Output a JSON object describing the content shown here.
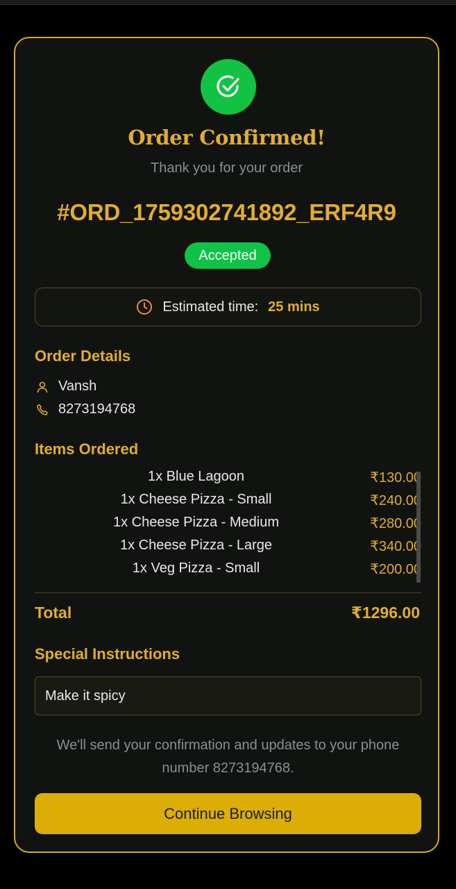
{
  "header": {
    "title": "Order Confirmed!",
    "subtitle": "Thank you for your order"
  },
  "order": {
    "id": "#ORD_1759302741892_ERF4R9",
    "status": "Accepted",
    "eta_label": "Estimated time:",
    "eta_value": "25 mins"
  },
  "details": {
    "section_title": "Order Details",
    "customer_name": "Vansh",
    "phone": "8273194768"
  },
  "items_section": {
    "section_title": "Items Ordered",
    "items": [
      {
        "name": "1x Blue Lagoon",
        "price": "₹130.00"
      },
      {
        "name": "1x Cheese Pizza - Small",
        "price": "₹240.00"
      },
      {
        "name": "1x Cheese Pizza - Medium",
        "price": "₹280.00"
      },
      {
        "name": "1x Cheese Pizza - Large",
        "price": "₹340.00"
      },
      {
        "name": "1x Veg Pizza - Small",
        "price": "₹200.00"
      }
    ]
  },
  "total": {
    "label": "Total",
    "value": "₹1296.00"
  },
  "instructions": {
    "section_title": "Special Instructions",
    "text": "Make it spicy"
  },
  "footer": {
    "note": "We'll send your confirmation and updates to your phone number 8273194768.",
    "button_label": "Continue Browsing"
  },
  "icons": {
    "success": "check-circle-icon",
    "clock": "clock-icon",
    "user": "user-icon",
    "phone": "phone-icon"
  },
  "colors": {
    "accent": "#e2ad2f",
    "success": "#12c243",
    "button": "#dcad05",
    "card_bg": "#111311"
  }
}
